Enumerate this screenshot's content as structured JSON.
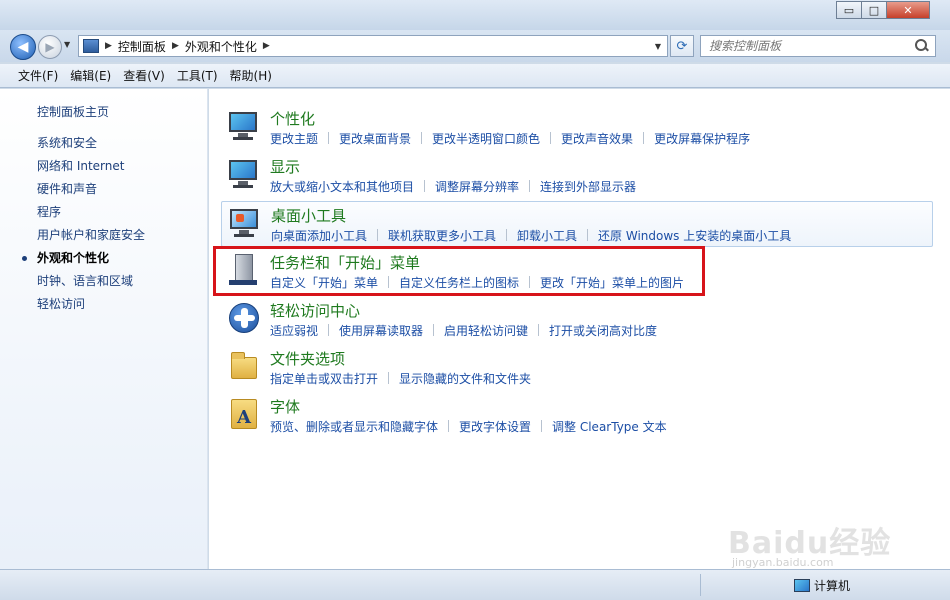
{
  "window": {
    "min_label": "▭",
    "max_label": "□",
    "close_label": "✕"
  },
  "navigation": {
    "back_glyph": "◀",
    "forward_glyph": "▶",
    "breadcrumb": [
      "控制面板",
      "外观和个性化"
    ],
    "search_placeholder": "搜索控制面板",
    "refresh_glyph": "⟳"
  },
  "menubar": [
    "文件(F)",
    "编辑(E)",
    "查看(V)",
    "工具(T)",
    "帮助(H)"
  ],
  "sidebar": {
    "home": "控制面板主页",
    "items": [
      {
        "label": "系统和安全",
        "active": false
      },
      {
        "label": "网络和 Internet",
        "active": false
      },
      {
        "label": "硬件和声音",
        "active": false
      },
      {
        "label": "程序",
        "active": false
      },
      {
        "label": "用户帐户和家庭安全",
        "active": false
      },
      {
        "label": "外观和个性化",
        "active": true
      },
      {
        "label": "时钟、语言和区域",
        "active": false
      },
      {
        "label": "轻松访问",
        "active": false
      }
    ]
  },
  "categories": [
    {
      "title": "个性化",
      "icon": "personalization-icon",
      "links": [
        "更改主题",
        "更改桌面背景",
        "更改半透明窗口颜色",
        "更改声音效果",
        "更改屏幕保护程序"
      ]
    },
    {
      "title": "显示",
      "icon": "display-icon",
      "links": [
        "放大或缩小文本和其他项目",
        "调整屏幕分辨率",
        "连接到外部显示器"
      ]
    },
    {
      "title": "桌面小工具",
      "icon": "desktop-gadgets-icon",
      "links": [
        "向桌面添加小工具",
        "联机获取更多小工具",
        "卸载小工具",
        "还原 Windows 上安装的桌面小工具"
      ]
    },
    {
      "title": "任务栏和「开始」菜单",
      "icon": "taskbar-start-menu-icon",
      "links": [
        "自定义「开始」菜单",
        "自定义任务栏上的图标",
        "更改「开始」菜单上的图片"
      ]
    },
    {
      "title": "轻松访问中心",
      "icon": "ease-of-access-icon",
      "links": [
        "适应弱视",
        "使用屏幕读取器",
        "启用轻松访问键",
        "打开或关闭高对比度"
      ]
    },
    {
      "title": "文件夹选项",
      "icon": "folder-options-icon",
      "links": [
        "指定单击或双击打开",
        "显示隐藏的文件和文件夹"
      ]
    },
    {
      "title": "字体",
      "icon": "fonts-icon",
      "links": [
        "预览、删除或者显示和隐藏字体",
        "更改字体设置",
        "调整 ClearType 文本"
      ]
    }
  ],
  "statusbar": {
    "location": "计算机"
  },
  "watermark": {
    "main": "Baidu经验",
    "sub": "jingyan.baidu.com"
  },
  "colors": {
    "category_title": "#1f7a1f",
    "link": "#1c4ea5",
    "highlight_box": "#d7141a"
  }
}
